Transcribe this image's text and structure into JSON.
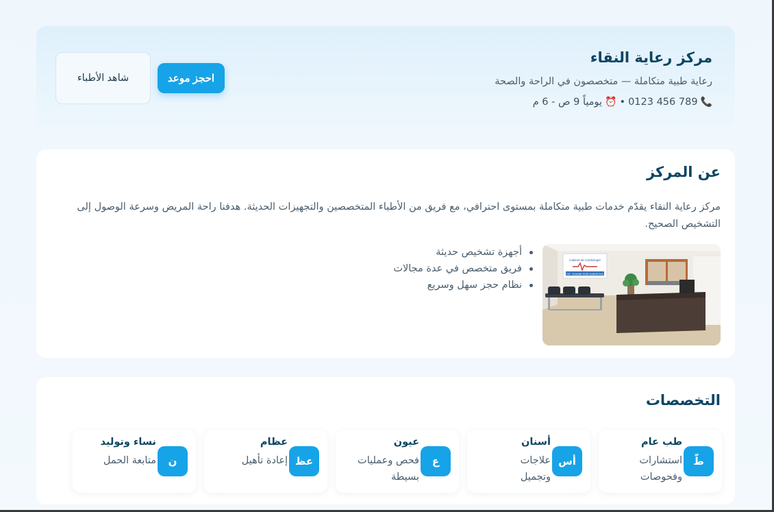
{
  "hero": {
    "title": "مركز رعاية النقاء",
    "subtitle": "رعاية طبية متكاملة — متخصصون في الراحة والصحة",
    "phone": "789 456 0123",
    "separator": "•",
    "hours": "يومياً 9 ص - 6 م",
    "book_label": "احجز موعد",
    "doctors_label": "شاهد الأطباء"
  },
  "about": {
    "title": "عن المركز",
    "text": "مركز رعاية النقاء يقدّم خدمات طبية متكاملة بمستوى احترافي، مع فريق من الأطباء المتخصصين والتجهيزات الحديثة. هدفنا راحة المريض وسرعة الوصول إلى التشخيص الصحيح.",
    "features": [
      "أجهزة تشخيص حديثة",
      "فريق متخصص في عدة مجالات",
      "نظام حجز سهل وسريع"
    ],
    "photo_sign": "DR. SHAABI SOB NABISOUA"
  },
  "specialties": {
    "title": "التخصصات",
    "items": [
      {
        "badge": "طّ",
        "name": "طب عام",
        "desc": "استشارات وفحوصات"
      },
      {
        "badge": "أس",
        "name": "أسنان",
        "desc": "علاجات وتجميل"
      },
      {
        "badge": "ع",
        "name": "عيون",
        "desc": "فحص وعمليات بسيطة"
      },
      {
        "badge": "عظ",
        "name": "عظام",
        "desc": "إعادة تأهيل"
      },
      {
        "badge": "ن",
        "name": "نساء وتوليد",
        "desc": "متابعة الحمل"
      }
    ]
  },
  "colors": {
    "accent": "#17a3e8",
    "title": "#0d4563",
    "text": "#4a5e6c"
  },
  "icons": {
    "phone": "phone-icon",
    "clock": "alarm-clock-icon"
  }
}
